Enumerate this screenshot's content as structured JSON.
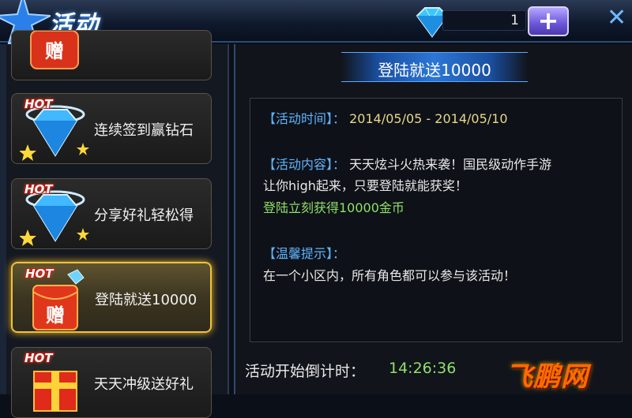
{
  "header": {
    "title": "活动",
    "currency_amount": "1",
    "add_label": "+",
    "close_label": "✕"
  },
  "activities": [
    {
      "label": "",
      "hot": "",
      "icon": "gift-box-icon",
      "selected": false
    },
    {
      "label": "连续签到赢钻石",
      "hot": "HOT",
      "icon": "diamond-icon",
      "selected": false
    },
    {
      "label": "分享好礼轻松得",
      "hot": "HOT",
      "icon": "diamond-icon",
      "selected": false
    },
    {
      "label": "登陆就送10000",
      "hot": "HOT",
      "icon": "red-envelope-icon",
      "selected": true
    },
    {
      "label": "天天冲级送好礼",
      "hot": "HOT",
      "icon": "gift-box-icon",
      "selected": false
    }
  ],
  "envelope_char": "赠",
  "detail": {
    "banner_title": "登陆就送10000",
    "time_key": "【活动时间】：",
    "time_value": "2014/05/05 - 2014/05/10",
    "content_key": "【活动内容】：",
    "content_line1": "天天炫斗火热来袭！国民级动作手游",
    "content_line2": "让你high起来，只要登陆就能获奖！",
    "reward_line": "登陆立刻获得10000金币",
    "tip_key": "【温馨提示】：",
    "tip_line": "在一个小区内，所有角色都可以参与该活动！"
  },
  "countdown": {
    "label": "活动开始倒计时：",
    "value": "14:26:36"
  },
  "watermark": "飞鹏网",
  "colors": {
    "accent_blue": "#5fb4ff",
    "highlight_green": "#8fe06a",
    "date_yellow": "#e8d88a",
    "selected_border": "#f0c33a"
  }
}
